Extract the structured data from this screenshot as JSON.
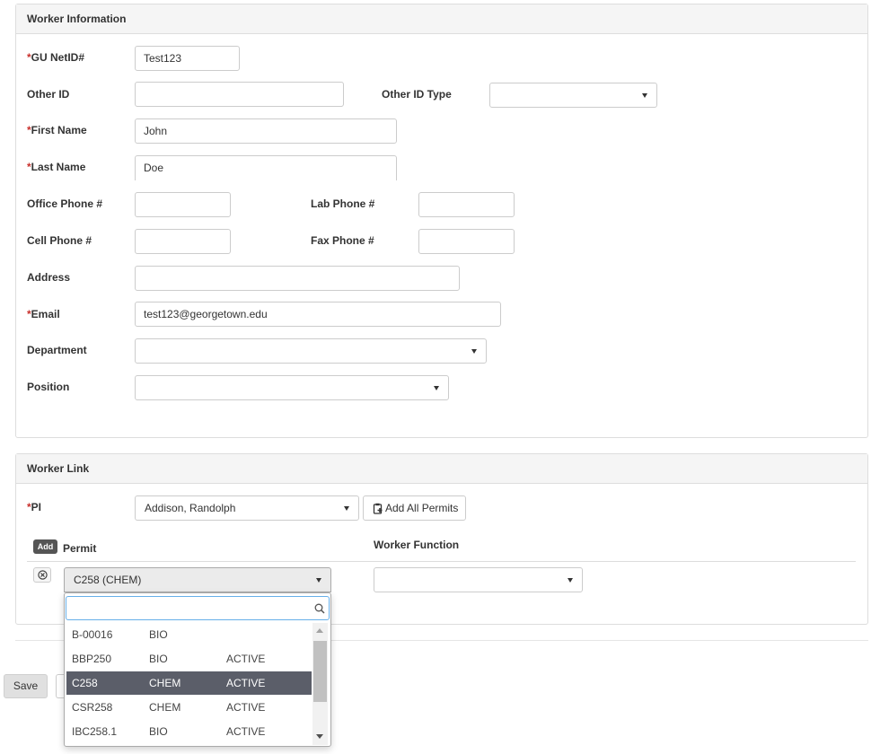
{
  "worker_info": {
    "heading": "Worker Information",
    "fields": {
      "gu_netid": {
        "label": "GU NetID#",
        "value": "Test123"
      },
      "other_id": {
        "label": "Other ID",
        "value": ""
      },
      "other_id_type": {
        "label": "Other ID Type",
        "value": ""
      },
      "first_name": {
        "label": "First Name",
        "value": "John"
      },
      "last_name": {
        "label": "Last Name",
        "value": "Doe"
      },
      "office_phone": {
        "label": "Office Phone #",
        "value": ""
      },
      "lab_phone": {
        "label": "Lab Phone #",
        "value": ""
      },
      "cell_phone": {
        "label": "Cell Phone #",
        "value": ""
      },
      "fax_phone": {
        "label": "Fax Phone #",
        "value": ""
      },
      "address": {
        "label": "Address",
        "value": ""
      },
      "email": {
        "label": "Email",
        "value": "test123@georgetown.edu"
      },
      "department": {
        "label": "Department",
        "value": ""
      },
      "position": {
        "label": "Position",
        "value": ""
      }
    },
    "required_marker": "*"
  },
  "worker_link": {
    "heading": "Worker Link",
    "pi": {
      "label": "PI",
      "value": "Addison, Randolph"
    },
    "add_all_permits_label": "Add All Permits",
    "add_label": "Add",
    "permit_header": "Permit",
    "worker_function_header": "Worker Function",
    "permit_selected": "C258 (CHEM)",
    "worker_function_value": ""
  },
  "permit_dropdown": {
    "search_value": "",
    "options": [
      {
        "code": "B-00016",
        "dept": "BIO",
        "status": ""
      },
      {
        "code": "BBP250",
        "dept": "BIO",
        "status": "ACTIVE"
      },
      {
        "code": "C258",
        "dept": "CHEM",
        "status": "ACTIVE"
      },
      {
        "code": "CSR258",
        "dept": "CHEM",
        "status": "ACTIVE"
      },
      {
        "code": "IBC258.1",
        "dept": "BIO",
        "status": "ACTIVE"
      }
    ],
    "selected_index": 2
  },
  "footer": {
    "save_label": "Save"
  },
  "icons": {
    "remove": "circled-x-icon",
    "search": "search-icon",
    "caret": "caret-down-icon",
    "add_permits": "clipboard-plus-icon",
    "scroll_up": "scroll-up-arrow-icon",
    "scroll_down": "scroll-down-arrow-icon"
  },
  "colors": {
    "required": "#c9302c",
    "selected_row": "#5b5e69",
    "panel_heading_bg": "#f5f5f5",
    "focus_border": "#66afe9"
  }
}
